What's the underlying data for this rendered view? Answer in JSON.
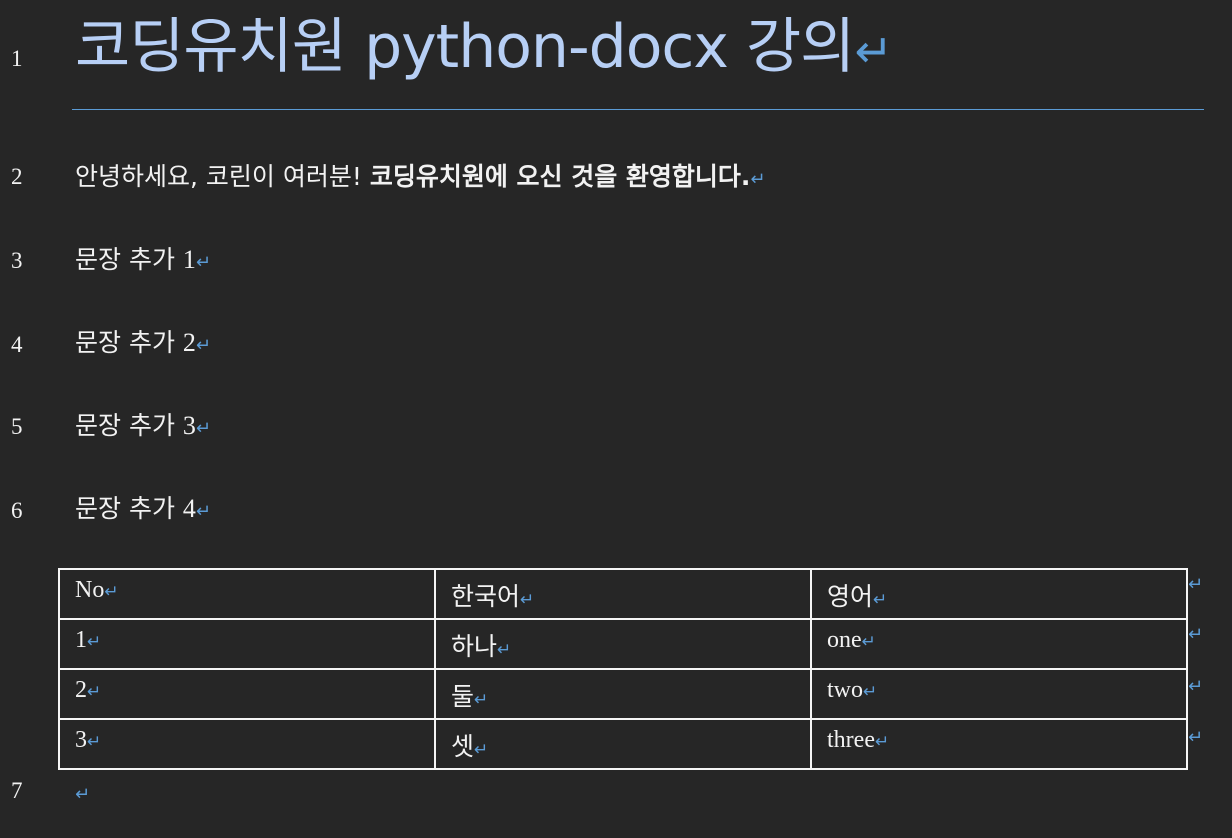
{
  "document": {
    "title": {
      "line_number": "1",
      "text": "코딩유치원 python-docx 강의",
      "mark": "↵"
    },
    "paragraphs": [
      {
        "line_number": "2",
        "normal_text": "안녕하세요, 코린이 여러분! ",
        "bold_text": "코딩유치원에 오신 것을 환영합니다.",
        "mark": "↵"
      },
      {
        "line_number": "3",
        "text": "문장 추가 ",
        "number": "1",
        "mark": "↵"
      },
      {
        "line_number": "4",
        "text": "문장 추가 ",
        "number": "2",
        "mark": "↵"
      },
      {
        "line_number": "5",
        "text": "문장 추가 ",
        "number": "3",
        "mark": "↵"
      },
      {
        "line_number": "6",
        "text": "문장 추가 ",
        "number": "4",
        "mark": "↵"
      }
    ],
    "table": {
      "headers": [
        "No",
        "한국어",
        "영어"
      ],
      "rows": [
        [
          "1",
          "하나",
          "one"
        ],
        [
          "2",
          "둘",
          "two"
        ],
        [
          "3",
          "셋",
          "three"
        ]
      ],
      "cell_mark": "↵",
      "row_end_mark": "↵"
    },
    "last_paragraph": {
      "line_number": "7",
      "mark": "↵"
    }
  },
  "colors": {
    "background": "#262626",
    "text": "#f2f2f2",
    "title": "#b7cff5",
    "formatting_marks": "#5b9bd5",
    "table_border": "#f5f5f5"
  }
}
